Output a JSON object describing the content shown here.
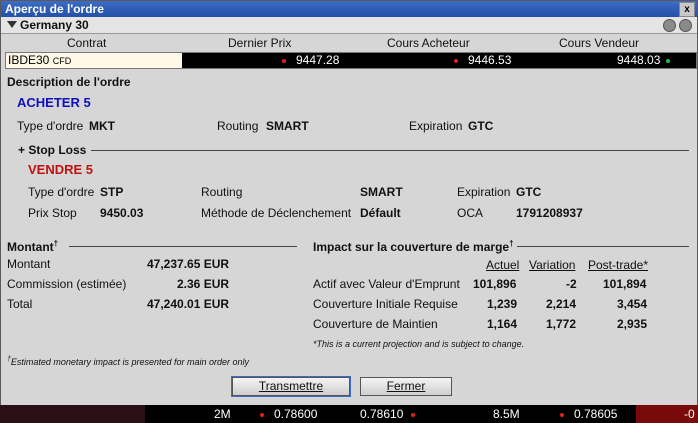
{
  "window": {
    "title": "Aperçu de l'ordre",
    "close_glyph": "x"
  },
  "instrument": {
    "name": "Germany 30"
  },
  "quote_header": {
    "contract": "Contrat",
    "last": "Dernier Prix",
    "bid": "Cours Acheteur",
    "ask": "Cours Vendeur"
  },
  "quote_row": {
    "symbol": "IBDE30",
    "symbol_type": "CFD",
    "last": "9447.28",
    "bid": "9446.53",
    "ask": "9448.03"
  },
  "order_desc": {
    "heading": "Description de l'ordre",
    "action": "ACHETER 5",
    "type_label": "Type d'ordre",
    "type_value": "MKT",
    "routing_label": "Routing",
    "routing_value": "SMART",
    "expiration_label": "Expiration",
    "expiration_value": "GTC"
  },
  "stop_loss": {
    "heading": "+ Stop Loss",
    "action": "VENDRE 5",
    "type_label": "Type d'ordre",
    "type_value": "STP",
    "routing_label": "Routing",
    "routing_value": "SMART",
    "expiration_label": "Expiration",
    "expiration_value": "GTC",
    "stop_label": "Prix Stop",
    "stop_value": "9450.03",
    "trigger_label": "Méthode de Déclenchement",
    "trigger_value": "Défault",
    "oca_label": "OCA",
    "oca_value": "1791208937"
  },
  "amount": {
    "heading": "Montant",
    "dagger": "†",
    "rows": [
      {
        "label": "Montant",
        "value": "47,237.65 EUR"
      },
      {
        "label": "Commission (estimée)",
        "value": "2.36 EUR"
      },
      {
        "label": "Total",
        "value": "47,240.01 EUR"
      }
    ]
  },
  "margin": {
    "heading": "Impact sur la couverture de marge",
    "dagger": "†",
    "cols": [
      "Actuel",
      "Variation",
      "Post-trade*"
    ],
    "rows": [
      {
        "label": "Actif avec Valeur d'Emprunt",
        "values": [
          "101,896",
          "-2",
          "101,894"
        ]
      },
      {
        "label": "Couverture Initiale Requise",
        "values": [
          "1,239",
          "2,214",
          "3,454"
        ]
      },
      {
        "label": "Couverture de Maintien",
        "values": [
          "1,164",
          "1,772",
          "2,935"
        ]
      }
    ],
    "note": "*This is a current projection and is subject to change."
  },
  "footnote_mark": "†",
  "footnote": "Estimated monetary impact is presented for main order only",
  "buttons": {
    "submit": "Transmettre",
    "close": "Fermer"
  },
  "bg_strip": {
    "v1": "2M",
    "v2": "0.78600",
    "v3": "0.78610",
    "v4": "8.5M",
    "v5": "0.78605",
    "v6": "-0"
  }
}
